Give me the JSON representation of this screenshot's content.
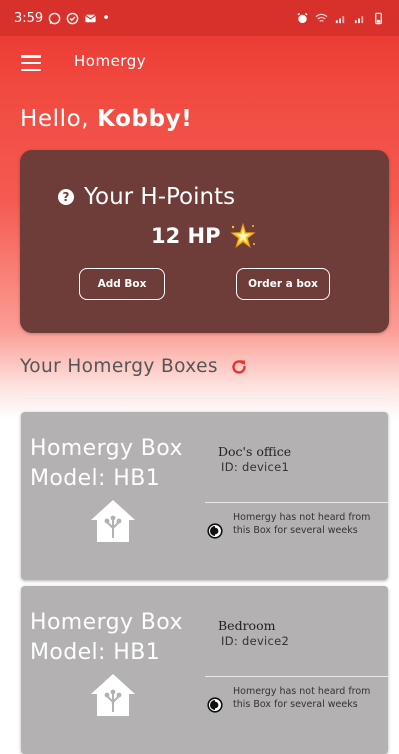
{
  "status_bar": {
    "time": "3:59",
    "dot": "•"
  },
  "app": {
    "title": "Homergy"
  },
  "greeting": {
    "prefix": "Hello, ",
    "name": "Kobby!"
  },
  "points": {
    "title": "Your H-Points",
    "value": "12 HP",
    "add_box_label": "Add Box",
    "order_box_label": "Order a box"
  },
  "boxes_section": {
    "title": "Your Homergy Boxes"
  },
  "boxes": [
    {
      "model_line1": "Homergy Box",
      "model_line2": "Model: HB1",
      "name": "Doc's office",
      "id": "ID: device1",
      "status": "Homergy has not heard from this Box for several weeks"
    },
    {
      "model_line1": "Homergy Box",
      "model_line2": "Model: HB1",
      "name": "Bedroom",
      "id": "ID: device2",
      "status": "Homergy has not heard from this Box for several weeks"
    }
  ],
  "colors": {
    "accent": "#e8322c",
    "card": "#6e3c39",
    "box_card": "#b3b1b1"
  },
  "icons": {
    "menu": "hamburger-icon",
    "help": "help-circle-icon",
    "star": "sparkle-star-icon",
    "refresh": "refresh-icon",
    "house": "smart-home-icon",
    "status": "clock-status-icon"
  }
}
